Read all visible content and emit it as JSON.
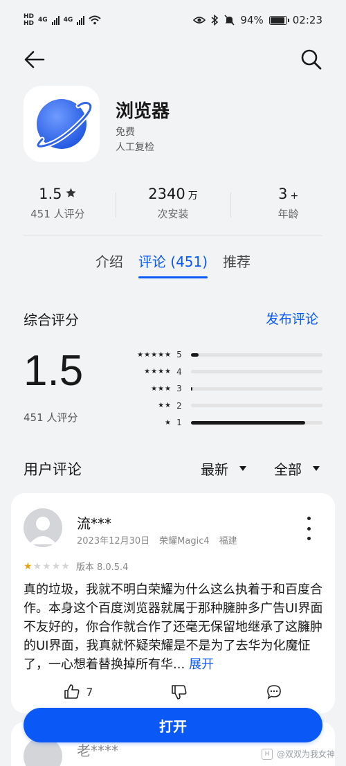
{
  "status_bar": {
    "left_labels": [
      "HD",
      "HD",
      "4G",
      "4G"
    ],
    "battery": "94%",
    "battery_level": 0.94,
    "time": "02:23",
    "icons": [
      "eye-icon",
      "bluetooth-icon",
      "mute-bell-icon",
      "battery-icon",
      "wifi-icon",
      "signal-icon"
    ]
  },
  "nav": {
    "back_icon": "arrow-left-icon",
    "search_icon": "search-icon"
  },
  "app": {
    "name": "浏览器",
    "price": "免费",
    "review_tag": "人工复检",
    "icon": "planet-icon",
    "brand_color": "#3a6ff0"
  },
  "stats": {
    "rating_value": "1.5",
    "rating_label": "451 人评分",
    "installs_value": "2340",
    "installs_unit": "万",
    "installs_label": "次安装",
    "age_value": "3",
    "age_unit": "+",
    "age_label": "年龄"
  },
  "tabs": [
    "介绍",
    "评论 (451)",
    "推荐"
  ],
  "active_tab": 1,
  "rating_summary": {
    "title": "综合评分",
    "post_review": "发布评论",
    "score": "1.5",
    "count": "451 人评分",
    "distribution": [
      {
        "stars": "★★★★★",
        "label": "5",
        "fraction": 0.06
      },
      {
        "stars": "★★★★",
        "label": "4",
        "fraction": 0.0
      },
      {
        "stars": "★★★",
        "label": "3",
        "fraction": 0.01
      },
      {
        "stars": "★★",
        "label": "2",
        "fraction": 0.0
      },
      {
        "stars": "★",
        "label": "1",
        "fraction": 0.87
      }
    ]
  },
  "user_reviews": {
    "title": "用户评论",
    "sort": "最新",
    "filter": "全部"
  },
  "review": {
    "name": "流***",
    "date": "2023年12月30日",
    "device": "荣耀Magic4",
    "location": "福建",
    "rating": 1,
    "max_rating": 5,
    "version": "版本 8.0.5.4",
    "body": "真的垃圾，我就不明白荣耀为什么这么执着于和百度合作。本身这个百度浏览器就属于那种臃肿多广告UI界面不友好的，你合作就合作了还毫无保留地继承了这臃肿的UI界面，我真就怀疑荣耀是不是为了去华为化魔怔了，一心想着替换掉所有华...",
    "expand": "展开",
    "likes": "7"
  },
  "review2": {
    "name": "老****"
  },
  "open_button": "打开",
  "watermark": "@双双为我女神",
  "accent_color": "#0a59f7"
}
